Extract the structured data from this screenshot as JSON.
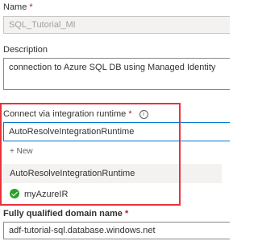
{
  "form": {
    "name": {
      "label": "Name",
      "required_mark": "*",
      "value": "SQL_Tutorial_MI"
    },
    "description": {
      "label": "Description",
      "value": "connection to Azure SQL DB using Managed Identity"
    },
    "integration_runtime": {
      "label": "Connect via integration runtime",
      "required_mark": "*",
      "info_icon": "info-icon",
      "selected": "AutoResolveIntegrationRuntime",
      "options": [
        {
          "label": "+ New"
        },
        {
          "label": "AutoResolveIntegrationRuntime"
        },
        {
          "label": "myAzureIR",
          "icon": "check-circle-icon"
        }
      ]
    },
    "fqdn": {
      "label": "Fully qualified domain name",
      "required_mark": "*",
      "value": "adf-tutorial-sql.database.windows.net"
    }
  },
  "colors": {
    "highlight_border": "#e8333b",
    "focus_border": "#0078d4",
    "required": "#a4262c",
    "check": "#2aa02a",
    "hover_bg": "#f3f2f1"
  }
}
